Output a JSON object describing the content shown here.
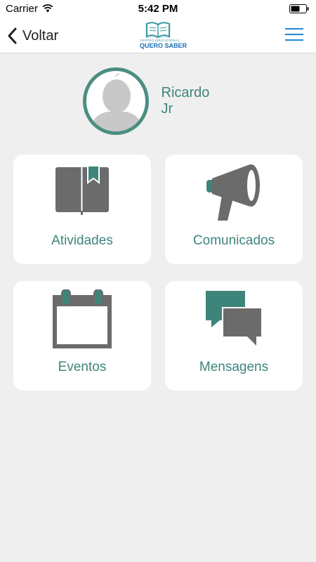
{
  "status_bar": {
    "carrier": "Carrier",
    "time": "5:42 PM"
  },
  "nav": {
    "back_label": "Voltar",
    "logo_line1": "CENTRO EDUCACIONAL",
    "logo_line2": "QUERO SABER"
  },
  "profile": {
    "name": "Ricardo Jr"
  },
  "menu": [
    {
      "label": "Atividades",
      "icon": "book-icon"
    },
    {
      "label": "Comunicados",
      "icon": "megaphone-icon"
    },
    {
      "label": "Eventos",
      "icon": "calendar-icon"
    },
    {
      "label": "Mensagens",
      "icon": "chat-bubbles-icon"
    }
  ],
  "colors": {
    "accent_teal": "#3d857a",
    "icon_gray": "#6b6b6b",
    "menu_blue": "#1f86d6",
    "background": "#efefef"
  }
}
